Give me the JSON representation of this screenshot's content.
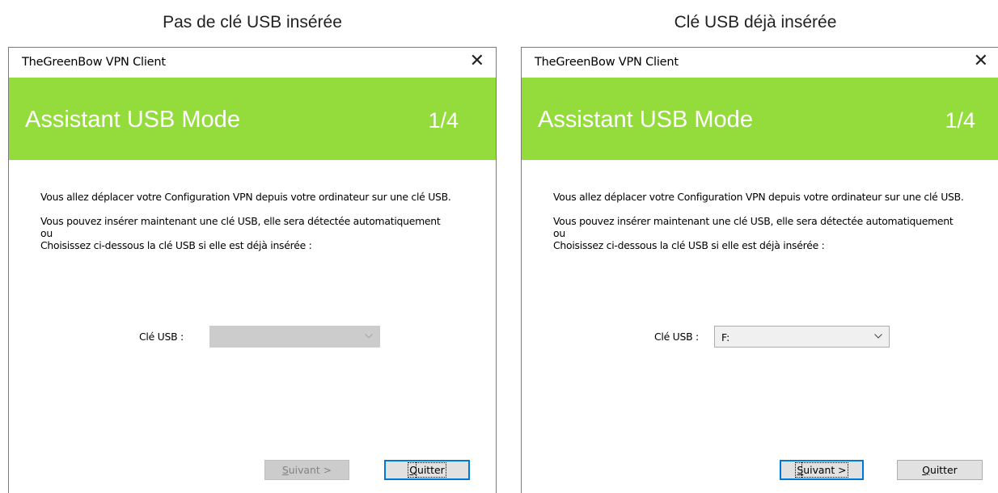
{
  "left": {
    "caption": "Pas de clé USB insérée",
    "window_title": "TheGreenBow VPN Client",
    "close_glyph": "✕",
    "banner_title": "Assistant USB Mode",
    "step": "1/4",
    "para1": "Vous allez déplacer votre Configuration VPN depuis votre ordinateur sur une clé USB.",
    "para2_line1": "Vous pouvez insérer maintenant une clé USB, elle sera détectée automatiquement",
    "para2_line2": "ou",
    "para2_line3": "Choisissez ci-dessous la clé USB si elle est déjà insérée :",
    "usb_label": "Clé USB :",
    "usb_value": "",
    "usb_enabled": false,
    "next_mnemonic": "S",
    "next_rest": "uivant >",
    "next_enabled": false,
    "quit_mnemonic": "Q",
    "quit_rest": "uitter",
    "default_button": "quit"
  },
  "right": {
    "caption": "Clé USB déjà insérée",
    "window_title": "TheGreenBow VPN Client",
    "close_glyph": "✕",
    "banner_title": "Assistant USB Mode",
    "step": "1/4",
    "para1": "Vous allez déplacer votre Configuration VPN depuis votre ordinateur sur une clé USB.",
    "para2_line1": "Vous pouvez insérer maintenant une clé USB, elle sera détectée automatiquement",
    "para2_line2": "ou",
    "para2_line3": "Choisissez ci-dessous la clé USB si elle est déjà insérée :",
    "usb_label": "Clé USB :",
    "usb_value": "F:",
    "usb_enabled": true,
    "next_mnemonic": "S",
    "next_rest": "uivant >",
    "next_enabled": true,
    "quit_mnemonic": "Q",
    "quit_rest": "uitter",
    "default_button": "next"
  },
  "colors": {
    "banner": "#94dc3c",
    "default_button_border": "#0078d7"
  },
  "icons": {
    "close": "close-icon",
    "dropdown": "chevron-down-icon"
  }
}
